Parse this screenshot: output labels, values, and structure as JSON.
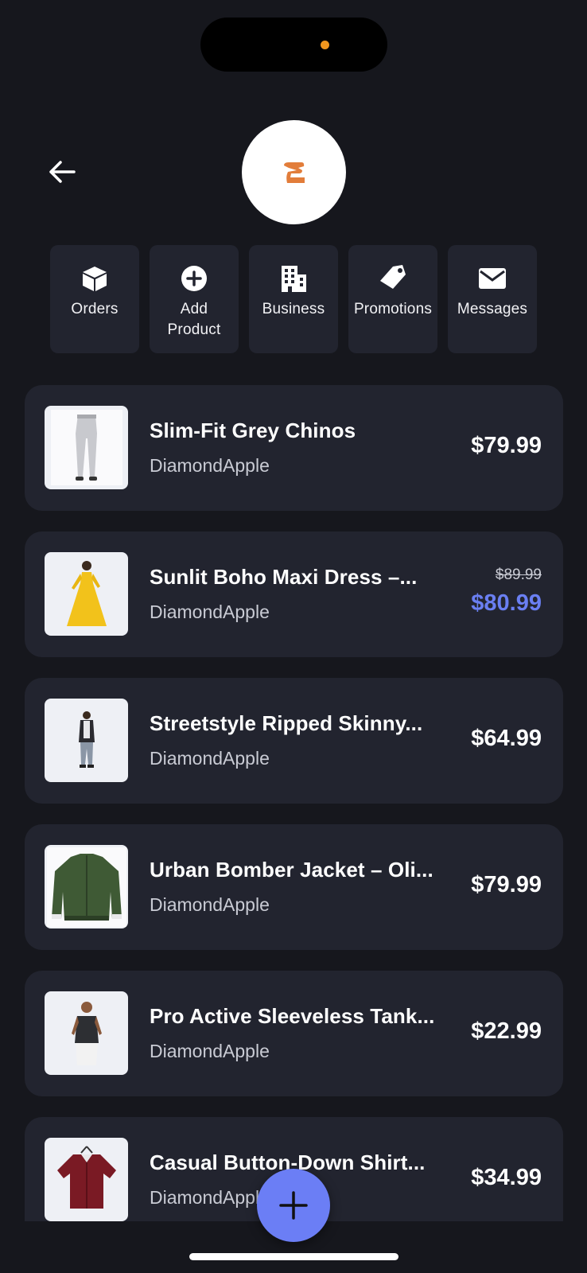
{
  "header": {
    "back_icon": "arrow-left-icon",
    "logo_icon": "store-logo-icon",
    "logo_color": "#e27d3a"
  },
  "actions": [
    {
      "label": "Orders",
      "icon": "box-icon"
    },
    {
      "label": "Add\nProduct",
      "icon": "plus-circle-icon"
    },
    {
      "label": "Business",
      "icon": "building-icon"
    },
    {
      "label": "Promotions",
      "icon": "tag-icon"
    },
    {
      "label": "Messages",
      "icon": "envelope-icon"
    }
  ],
  "products": [
    {
      "title": "Slim-Fit Grey Chinos",
      "seller": "DiamondApple",
      "price": "$79.99"
    },
    {
      "title": "Sunlit Boho Maxi Dress –...",
      "seller": "DiamondApple",
      "original_price": "$89.99",
      "sale_price": "$80.99"
    },
    {
      "title": "Streetstyle Ripped Skinny...",
      "seller": "DiamondApple",
      "price": "$64.99"
    },
    {
      "title": "Urban Bomber Jacket – Oli...",
      "seller": "DiamondApple",
      "price": "$79.99"
    },
    {
      "title": "Pro Active Sleeveless Tank...",
      "seller": "DiamondApple",
      "price": "$22.99"
    },
    {
      "title": "Casual Button-Down Shirt...",
      "seller": "DiamondApple",
      "price": "$34.99"
    }
  ],
  "fab": {
    "icon": "plus-icon"
  },
  "colors": {
    "background": "#16171d",
    "card": "#22242f",
    "accent": "#6b7ef5",
    "sale": "#6a7ff2"
  }
}
